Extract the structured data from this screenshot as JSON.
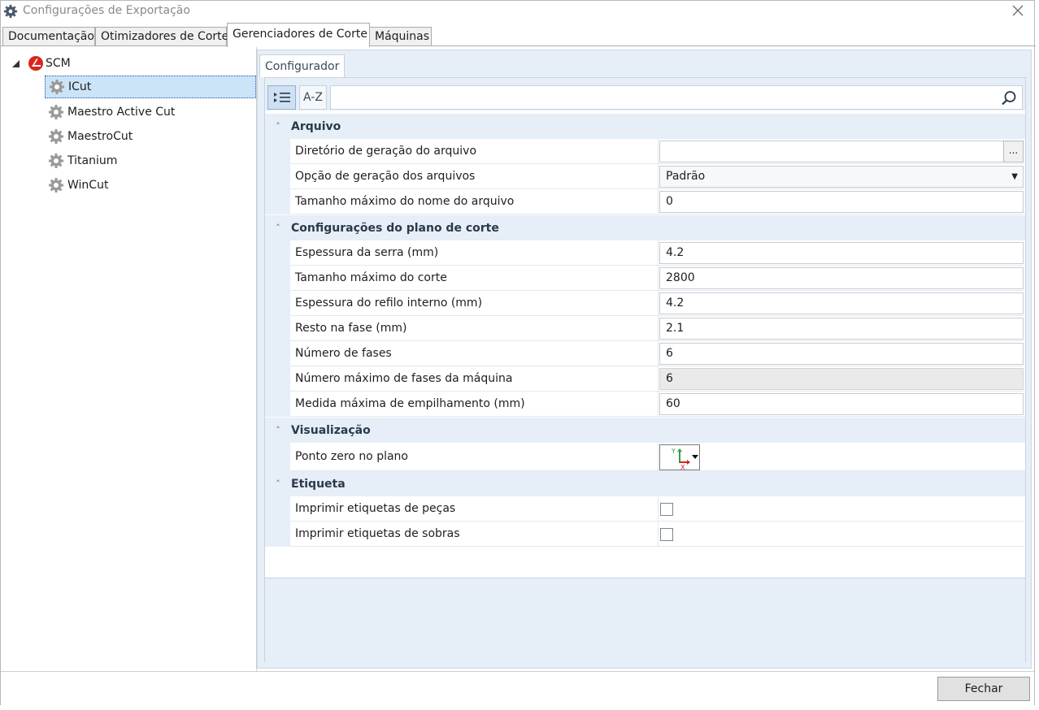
{
  "window": {
    "title": "Configurações de Exportação"
  },
  "tabs": [
    {
      "label": "Documentação"
    },
    {
      "label": "Otimizadores de Corte"
    },
    {
      "label": "Gerenciadores de Corte"
    },
    {
      "label": "Máquinas"
    }
  ],
  "tree": {
    "root": {
      "label": "SCM"
    },
    "items": [
      {
        "label": "ICut"
      },
      {
        "label": "Maestro Active Cut"
      },
      {
        "label": "MaestroCut"
      },
      {
        "label": "Titanium"
      },
      {
        "label": "WinCut"
      }
    ]
  },
  "configurator": {
    "tab_label": "Configurador",
    "toolbar": {
      "categorized_label": "",
      "alpha_label": "A-Z",
      "search_placeholder": ""
    },
    "categories": [
      {
        "label": "Arquivo",
        "rows": [
          {
            "name": "Diretório de geração do arquivo",
            "value": "",
            "browse_label": "..."
          },
          {
            "name": "Opção de geração dos arquivos",
            "value": "Padrão"
          },
          {
            "name": "Tamanho máximo do nome do arquivo",
            "value": "0"
          }
        ]
      },
      {
        "label": "Configurações do plano de corte",
        "rows": [
          {
            "name": "Espessura da serra (mm)",
            "value": "4.2"
          },
          {
            "name": "Tamanho máximo do corte",
            "value": "2800"
          },
          {
            "name": "Espessura do refilo interno (mm)",
            "value": "4.2"
          },
          {
            "name": "Resto na fase (mm)",
            "value": "2.1"
          },
          {
            "name": "Número de fases",
            "value": "6"
          },
          {
            "name": "Número máximo de fases da máquina",
            "value": "6"
          },
          {
            "name": "Medida máxima de empilhamento (mm)",
            "value": "60"
          }
        ]
      },
      {
        "label": "Visualização",
        "rows": [
          {
            "name": "Ponto zero no plano",
            "axis_y": "Y",
            "axis_x": "X"
          }
        ]
      },
      {
        "label": "Etiqueta",
        "rows": [
          {
            "name": "Imprimir etiquetas de peças",
            "checked": false
          },
          {
            "name": "Imprimir etiquetas de sobras",
            "checked": false
          }
        ]
      }
    ]
  },
  "footer": {
    "close_label": "Fechar"
  },
  "colors": {
    "accent": "#1e5aa8",
    "selection": "#cce4f7",
    "grid_bg": "#e6eef7",
    "logo_red": "#d9261c"
  }
}
